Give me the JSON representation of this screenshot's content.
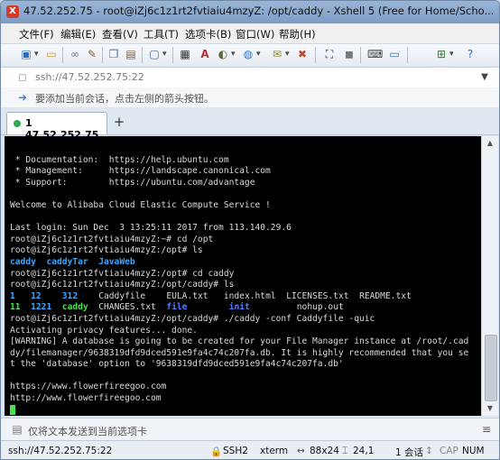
{
  "window": {
    "title": "47.52.252.75 - root@iZj6c1z1rt2fvtiaiu4mzyZ: /opt/caddy - Xshell 5 (Free for Home/Scho..."
  },
  "menu": {
    "items": [
      "文件(F)",
      "编辑(E)",
      "查看(V)",
      "工具(T)",
      "选项卡(B)",
      "窗口(W)",
      "帮助(H)"
    ]
  },
  "toolbar": {
    "icons": [
      "new-session-icon",
      "open-icon",
      "link-icon",
      "pencil-icon",
      "copy-icon",
      "paste-icon",
      "screen-icon",
      "font-icon",
      "color-icon",
      "globe-icon",
      "transfer-icon",
      "fullscreen-icon",
      "lock-icon",
      "keyboard-icon",
      "add-icon",
      "help-icon"
    ]
  },
  "address": {
    "value": "ssh://47.52.252.75:22"
  },
  "hint": {
    "text": "要添加当前会话，点击左侧的箭头按钮。"
  },
  "tabs": [
    {
      "label": "1 47.52.252.75",
      "active": true
    }
  ],
  "new_tab_label": "+",
  "terminal": {
    "lines_before_ls": [
      "",
      " * Documentation:  https://help.ubuntu.com",
      " * Management:     https://landscape.canonical.com",
      " * Support:        https://ubuntu.com/advantage",
      "",
      "Welcome to Alibaba Cloud Elastic Compute Service !",
      "",
      "Last login: Sun Dec  3 13:25:11 2017 from 113.140.29.6",
      "root@iZj6c1z1rt2fvtiaiu4mzyZ:~# cd /opt",
      "root@iZj6c1z1rt2fvtiaiu4mzyZ:/opt# ls"
    ],
    "ls_opt": [
      "caddy",
      "caddyTar",
      "JavaWeb"
    ],
    "lines_mid": [
      "root@iZj6c1z1rt2fvtiaiu4mzyZ:/opt# cd caddy",
      "root@iZj6c1z1rt2fvtiaiu4mzyZ:/opt/caddy# ls"
    ],
    "ls_row1": [
      "1",
      "12",
      "312",
      "Caddyfile",
      "EULA.txt",
      "index.html",
      "LICENSES.txt",
      "README.txt"
    ],
    "ls_row2": [
      "11",
      "1221",
      "caddy",
      "CHANGES.txt",
      "file",
      "init",
      "nohup.out"
    ],
    "lines_after": [
      "root@iZj6c1z1rt2fvtiaiu4mzyZ:/opt/caddy# ./caddy -conf Caddyfile -quic",
      "Activating privacy features... done.",
      "[WARNING] A database is going to be created for your File Manager instance at /root/.cad",
      "dy/filemanager/9638319dfd9dced591e9fa4c74c207fa.db. It is highly recommended that you se",
      "t the 'database' option to '9638319dfd9dced591e9fa4c74c207fa.db'",
      "",
      "https://www.flowerfireegoo.com",
      "http://www.flowerfireegoo.com"
    ]
  },
  "sendbar": {
    "text": "仅将文本发送到当前选项卡"
  },
  "status": {
    "address": "ssh://47.52.252.75:22",
    "protocol": "SSH2",
    "terminal": "xterm",
    "size": "88x24",
    "position": "24,1",
    "sessions": "1 会话",
    "cap": "CAP",
    "num": "NUM"
  },
  "colors": {
    "dir": "#3ea7ff",
    "exec": "#46e34b",
    "blue": "#4f7cff",
    "terminal_bg": "#000000"
  }
}
